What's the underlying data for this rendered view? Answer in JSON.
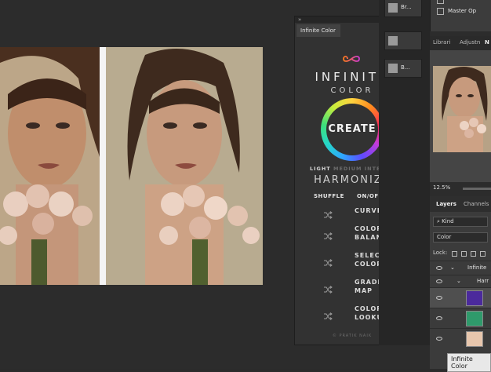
{
  "plugin": {
    "tab_label": "Infinite Color",
    "brand_line1": "INFINITE",
    "brand_line2": "COLOR",
    "create_label": "CREATE",
    "intensity": [
      "LIGHT",
      " MEDIUM",
      " INTENSE"
    ],
    "harmonize_label": "HARMONIZE",
    "shuffle_header": "SHUFFLE",
    "onoff_header": "ON/OFF",
    "adjustments": [
      "CURVES",
      [
        "COLOR",
        "BALANCE"
      ],
      [
        "SELECTIVE",
        "COLOR"
      ],
      [
        "GRADIENT",
        "MAP"
      ],
      [
        "COLOR",
        "LOOKUP"
      ]
    ],
    "footer": "© PRATIK NAIK"
  },
  "strip": {
    "buttons": [
      "Br...",
      "",
      "B..."
    ]
  },
  "history": {
    "items": [
      "",
      "Master Op"
    ]
  },
  "tabs": [
    "Librari",
    "Adjustn",
    "N"
  ],
  "navigator": {
    "zoom": "12.5%"
  },
  "layers": {
    "tabs": [
      "Layers",
      "Channels"
    ],
    "filter_kind": "Kind",
    "blend_mode": "Color",
    "lock_label": "Lock:",
    "rows": [
      "Infinite",
      "Harr"
    ],
    "tooltip": "Infinite Color"
  }
}
